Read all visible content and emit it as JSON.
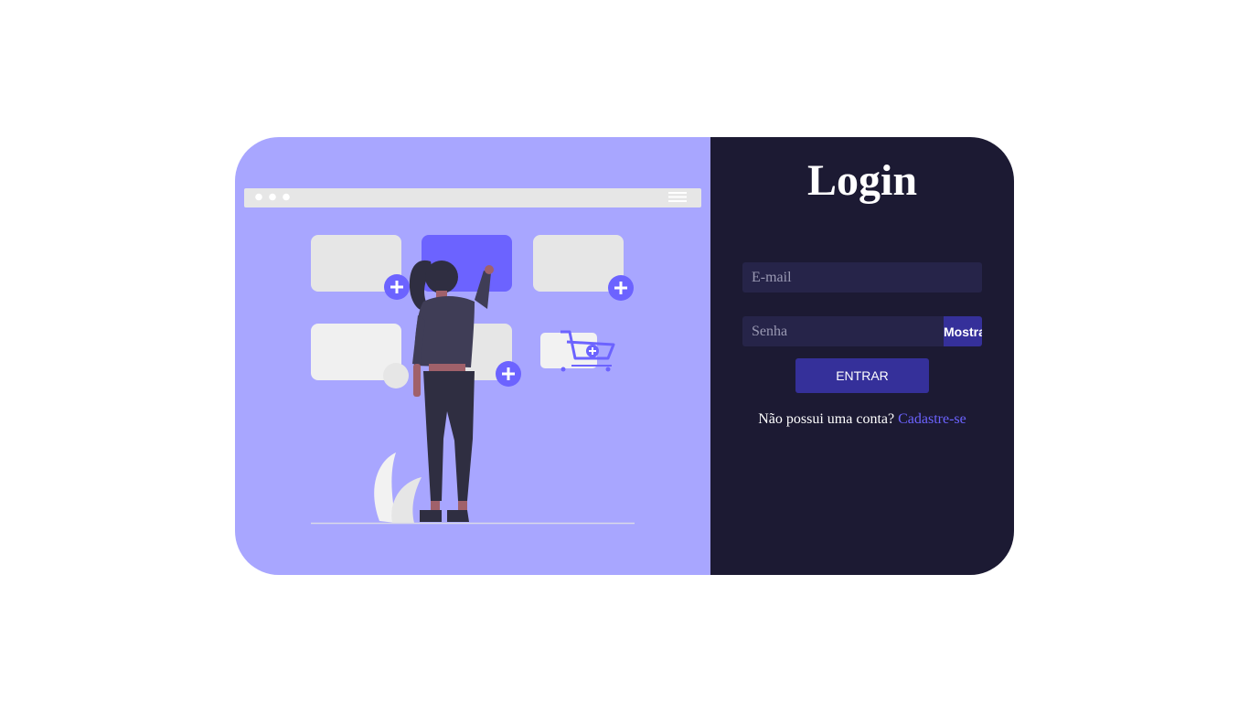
{
  "login": {
    "title": "Login",
    "email_placeholder": "E-mail",
    "password_placeholder": "Senha",
    "show_password_label": "Mostrar",
    "submit_label": "ENTRAR",
    "signup_prompt": "Não possui uma conta?",
    "signup_link": "Cadastre-se"
  },
  "colors": {
    "illustration_background": "#a8a6ff",
    "form_background": "#1c1a33",
    "input_background": "#262449",
    "button_color": "#35309a",
    "link_color": "#6c63ff",
    "accent": "#6c63ff"
  },
  "icons": [
    "ellipsis-dots-icon",
    "hamburger-menu-icon",
    "plus-icon",
    "shopping-cart-icon"
  ]
}
